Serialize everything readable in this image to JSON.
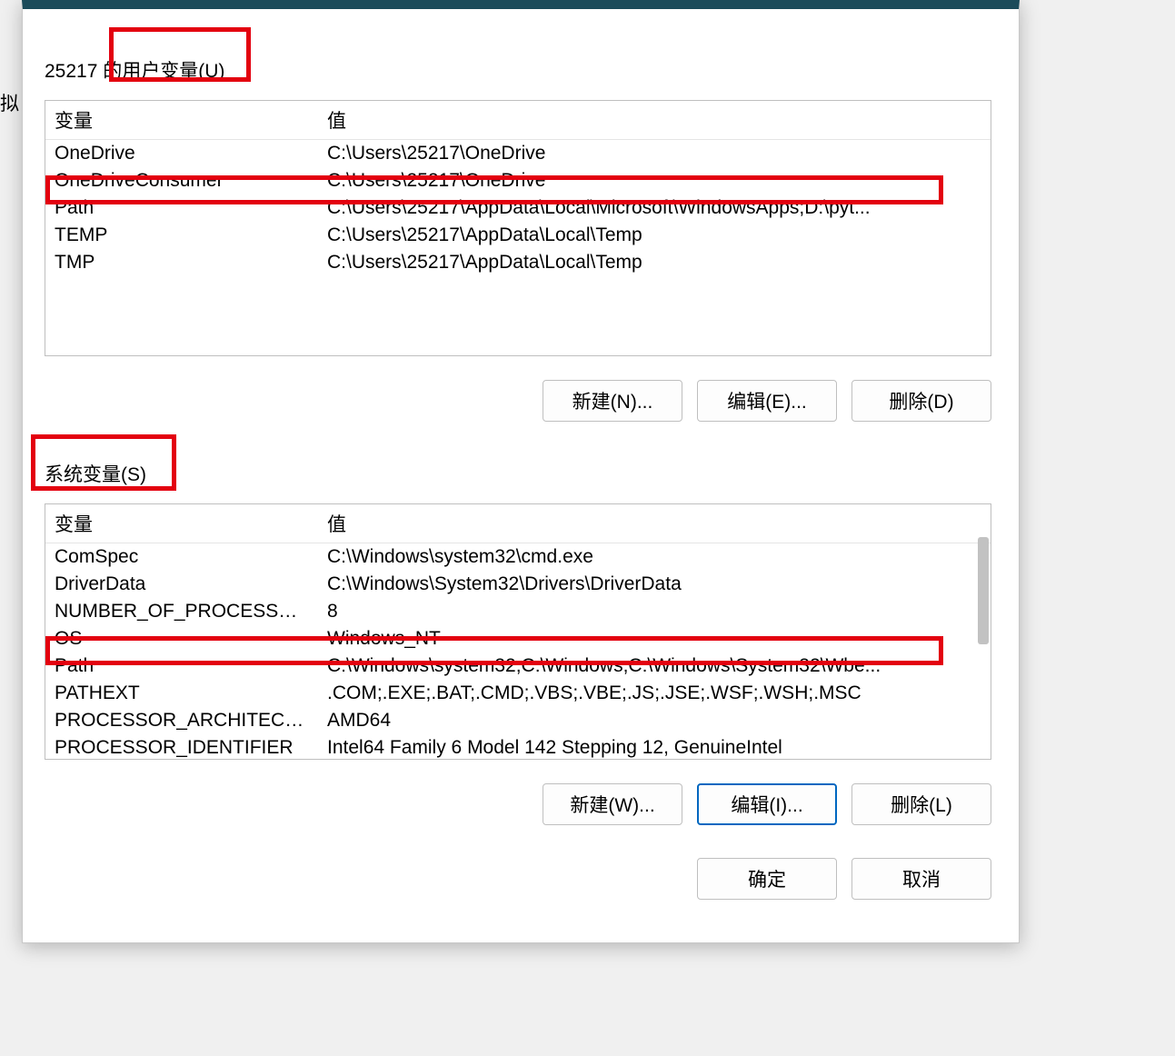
{
  "left_fragment_text": "拟",
  "user_section": {
    "label": "25217 的用户变量(U)",
    "header_name": "变量",
    "header_value": "值",
    "rows": [
      {
        "name": "OneDrive",
        "value": "C:\\Users\\25217\\OneDrive"
      },
      {
        "name": "OneDriveConsumer",
        "value": "C:\\Users\\25217\\OneDrive"
      },
      {
        "name": "Path",
        "value": "C:\\Users\\25217\\AppData\\Local\\Microsoft\\WindowsApps;D:\\pyt..."
      },
      {
        "name": "TEMP",
        "value": "C:\\Users\\25217\\AppData\\Local\\Temp"
      },
      {
        "name": "TMP",
        "value": "C:\\Users\\25217\\AppData\\Local\\Temp"
      }
    ],
    "buttons": {
      "new": "新建(N)...",
      "edit": "编辑(E)...",
      "delete": "删除(D)"
    }
  },
  "system_section": {
    "label": "系统变量(S)",
    "header_name": "变量",
    "header_value": "值",
    "rows": [
      {
        "name": "ComSpec",
        "value": "C:\\Windows\\system32\\cmd.exe"
      },
      {
        "name": "DriverData",
        "value": "C:\\Windows\\System32\\Drivers\\DriverData"
      },
      {
        "name": "NUMBER_OF_PROCESSORS",
        "value": "8"
      },
      {
        "name": "OS",
        "value": "Windows_NT"
      },
      {
        "name": "Path",
        "value": "C:\\Windows\\system32;C:\\Windows;C:\\Windows\\System32\\Wbe..."
      },
      {
        "name": "PATHEXT",
        "value": ".COM;.EXE;.BAT;.CMD;.VBS;.VBE;.JS;.JSE;.WSF;.WSH;.MSC"
      },
      {
        "name": "PROCESSOR_ARCHITECTU...",
        "value": "AMD64"
      },
      {
        "name": "PROCESSOR_IDENTIFIER",
        "value": "Intel64 Family 6 Model 142 Stepping 12, GenuineIntel"
      }
    ],
    "buttons": {
      "new": "新建(W)...",
      "edit": "编辑(I)...",
      "delete": "删除(L)"
    }
  },
  "footer": {
    "ok": "确定",
    "cancel": "取消"
  }
}
